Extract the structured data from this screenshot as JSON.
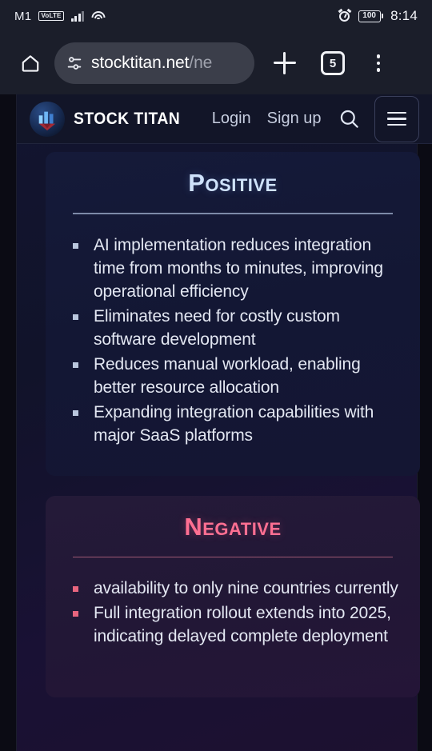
{
  "status_bar": {
    "carrier": "M1",
    "network_badge": "VoLTE",
    "signal_icon": "signal-bars-icon",
    "wifi_icon": "wifi-icon",
    "alarm_icon": "alarm-clock-icon",
    "battery_level": "100",
    "time": "8:14"
  },
  "browser": {
    "home_icon": "home-icon",
    "site_settings_icon": "tune-icon",
    "url_host": "stocktitan.net",
    "url_path": "/ne",
    "new_tab_icon": "plus-icon",
    "tab_count": "5",
    "overflow_icon": "three-dot-menu-icon"
  },
  "site_header": {
    "logo_icon": "stock-titan-logo-icon",
    "brand_name": "STOCK TITAN",
    "login_label": "Login",
    "signup_label": "Sign up",
    "search_icon": "search-icon",
    "hamburger_icon": "hamburger-menu-icon"
  },
  "cards": [
    {
      "id": "positive",
      "title": "Positive",
      "accent_color": "#cfe2fb",
      "bullets": [
        "AI implementation reduces integration time from months to minutes, improving operational efficiency",
        "Eliminates need for costly custom software development",
        "Reduces manual workload, enabling better resource allocation",
        "Expanding integration capabilities with major SaaS platforms"
      ]
    },
    {
      "id": "negative",
      "title": "Negative",
      "accent_color": "#ff6f92",
      "bullets": [
        "availability to only nine countries currently",
        "Full integration rollout extends into 2025, indicating delayed complete deployment"
      ]
    }
  ]
}
